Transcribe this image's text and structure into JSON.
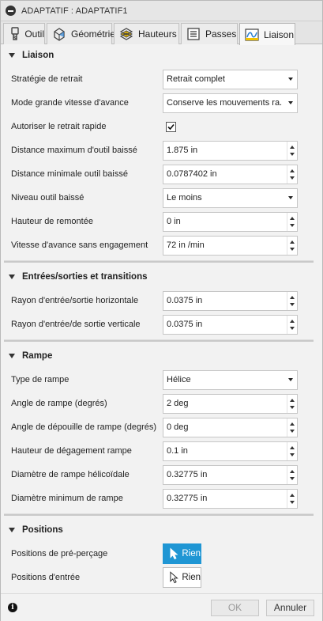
{
  "window": {
    "title": "ADAPTATIF : ADAPTATIF1"
  },
  "tabs": [
    {
      "label": "Outil",
      "icon": "tool-icon"
    },
    {
      "label": "Géométrie",
      "icon": "geometry-icon"
    },
    {
      "label": "Hauteurs",
      "icon": "heights-icon"
    },
    {
      "label": "Passes",
      "icon": "passes-icon"
    },
    {
      "label": "Liaison",
      "icon": "linking-icon",
      "active": true
    }
  ],
  "sections": {
    "liaison": {
      "title": "Liaison",
      "rows": {
        "strategie": {
          "label": "Stratégie de retrait",
          "value": "Retrait complet"
        },
        "mode": {
          "label": "Mode grande vitesse d'avance",
          "value": "Conserve les mouvements ra..."
        },
        "autoriser": {
          "label": "Autoriser le retrait rapide",
          "checked": true
        },
        "dist_max": {
          "label": "Distance maximum d'outil baissé",
          "value": "1.875 in"
        },
        "dist_min": {
          "label": "Distance minimale outil baissé",
          "value": "0.0787402 in"
        },
        "niveau": {
          "label": "Niveau outil baissé",
          "value": "Le moins"
        },
        "hauteur": {
          "label": "Hauteur de remontée",
          "value": "0 in"
        },
        "vitesse": {
          "label": "Vitesse d'avance sans engagement",
          "value": "72 in /min"
        }
      }
    },
    "entrees": {
      "title": "Entrées/sorties et transitions",
      "rows": {
        "rayon_h": {
          "label": "Rayon d'entrée/sortie horizontale",
          "value": "0.0375 in"
        },
        "rayon_v": {
          "label": "Rayon d'entrée/de sortie verticale",
          "value": "0.0375 in"
        }
      }
    },
    "rampe": {
      "title": "Rampe",
      "rows": {
        "type": {
          "label": "Type de rampe",
          "value": "Hélice"
        },
        "angle": {
          "label": "Angle de rampe (degrés)",
          "value": "2 deg"
        },
        "depouille": {
          "label": "Angle de dépouille de rampe (degrés)",
          "value": "0 deg"
        },
        "degagement": {
          "label": "Hauteur de dégagement rampe",
          "value": "0.1 in"
        },
        "diam_helic": {
          "label": "Diamètre de rampe hélicoïdale",
          "value": "0.32775 in"
        },
        "diam_min": {
          "label": "Diamètre minimum de rampe",
          "value": "0.32775 in"
        }
      }
    },
    "positions": {
      "title": "Positions",
      "rows": {
        "pre_percage": {
          "label": "Positions de pré-perçage",
          "value": "Rien",
          "selected": true
        },
        "entree": {
          "label": "Positions d'entrée",
          "value": "Rien"
        }
      }
    }
  },
  "footer": {
    "ok": "OK",
    "cancel": "Annuler",
    "info_icon": "info-icon"
  },
  "colors": {
    "accent": "#1f96d4",
    "tab_active_accent": "#f2c200"
  }
}
